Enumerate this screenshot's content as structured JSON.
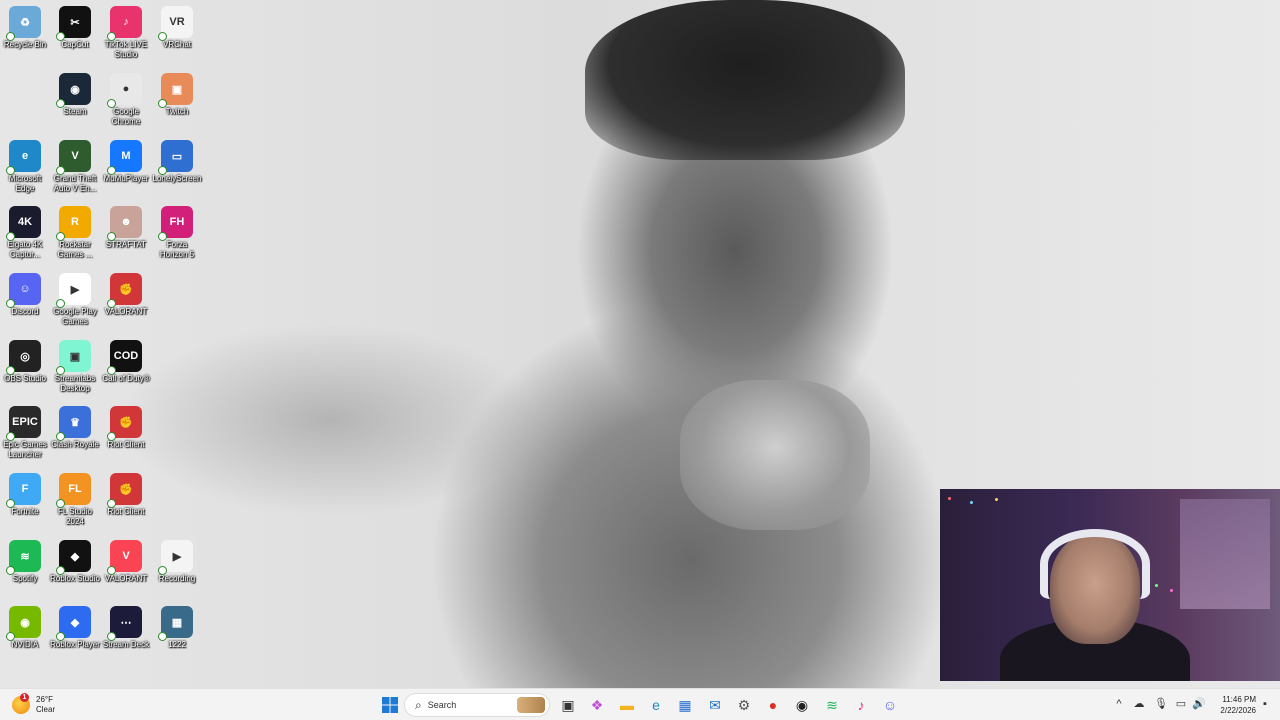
{
  "desktop": {
    "icons": [
      {
        "label": "Recycle Bin",
        "name": "recycle-bin-icon",
        "glyph": "♻",
        "bg": "#6aa9d8"
      },
      {
        "label": "CapCut",
        "name": "capcut-icon",
        "glyph": "✂",
        "bg": "#111111"
      },
      {
        "label": "TikTok LIVE Studio",
        "name": "tiktok-live-studio-icon",
        "glyph": "♪",
        "bg": "#e8336d"
      },
      {
        "label": "VRChat",
        "name": "vrchat-icon",
        "glyph": "VR",
        "bg": "#f4f4f4"
      },
      {
        "label": "Steam",
        "name": "steam-icon",
        "glyph": "◉",
        "bg": "#1b2838"
      },
      {
        "label": "Google Chrome",
        "name": "chrome-icon",
        "glyph": "●",
        "bg": "#e8e8e8"
      },
      {
        "label": "Twitch",
        "name": "twitch-icon",
        "glyph": "▣",
        "bg": "#e98b59"
      },
      {
        "label": "Microsoft Edge",
        "name": "edge-icon",
        "glyph": "e",
        "bg": "#1e88c9"
      },
      {
        "label": "Grand Theft Auto V En...",
        "name": "gta-icon",
        "glyph": "V",
        "bg": "#2e5c2f"
      },
      {
        "label": "MuMuPlayer",
        "name": "mumuplayer-icon",
        "glyph": "M",
        "bg": "#1677ff"
      },
      {
        "label": "LonelyScreen",
        "name": "lonelyscreen-icon",
        "glyph": "▭",
        "bg": "#2f6fd1"
      },
      {
        "label": "Elgato 4K Captur...",
        "name": "elgato-icon",
        "glyph": "4K",
        "bg": "#1b1b2e"
      },
      {
        "label": "Rockstar Games ...",
        "name": "rockstar-icon",
        "glyph": "R",
        "bg": "#f2a900"
      },
      {
        "label": "STRAFTAT",
        "name": "straftat-icon",
        "glyph": "☻",
        "bg": "#c9a29a"
      },
      {
        "label": "Forza Horizon 5",
        "name": "forza-icon",
        "glyph": "FH",
        "bg": "#d21f7a"
      },
      {
        "label": "Discord",
        "name": "discord-icon",
        "glyph": "☺",
        "bg": "#5865f2"
      },
      {
        "label": "Google Play Games",
        "name": "google-play-games-icon",
        "glyph": "▶",
        "bg": "#ffffff"
      },
      {
        "label": "VALORANT",
        "name": "valorant-riot-icon",
        "glyph": "✊",
        "bg": "#d13639"
      },
      {
        "label": "OBS Studio",
        "name": "obs-icon",
        "glyph": "◎",
        "bg": "#222222"
      },
      {
        "label": "Streamlabs Desktop",
        "name": "streamlabs-icon",
        "glyph": "▣",
        "bg": "#80f5d2"
      },
      {
        "label": "Call of Duty®",
        "name": "call-of-duty-icon",
        "glyph": "COD",
        "bg": "#111111"
      },
      {
        "label": "Epic Games Launcher",
        "name": "epic-games-icon",
        "glyph": "EPIC",
        "bg": "#2a2a2a"
      },
      {
        "label": "Clash Royale",
        "name": "clash-royale-icon",
        "glyph": "♛",
        "bg": "#3b6fd9"
      },
      {
        "label": "Riot Client",
        "name": "riot-client-icon-1",
        "glyph": "✊",
        "bg": "#d13639"
      },
      {
        "label": "Fortnite",
        "name": "fortnite-icon",
        "glyph": "F",
        "bg": "#3fa9f5"
      },
      {
        "label": "FL Studio 2024",
        "name": "fl-studio-icon",
        "glyph": "FL",
        "bg": "#f29322"
      },
      {
        "label": "Riot Client",
        "name": "riot-client-icon-2",
        "glyph": "✊",
        "bg": "#d13639"
      },
      {
        "label": "Spotify",
        "name": "spotify-icon",
        "glyph": "≋",
        "bg": "#1db954"
      },
      {
        "label": "Roblox Studio",
        "name": "roblox-studio-icon",
        "glyph": "◆",
        "bg": "#111111"
      },
      {
        "label": "VALORANT",
        "name": "valorant-icon",
        "glyph": "V",
        "bg": "#fa4454"
      },
      {
        "label": "Recording",
        "name": "recording-file-icon",
        "glyph": "▶",
        "bg": "#f4f4f4"
      },
      {
        "label": "NVIDIA",
        "name": "nvidia-icon",
        "glyph": "◉",
        "bg": "#76b900"
      },
      {
        "label": "Roblox Player",
        "name": "roblox-player-icon",
        "glyph": "◆",
        "bg": "#2d6cf0"
      },
      {
        "label": "Stream Deck",
        "name": "stream-deck-icon",
        "glyph": "⋯",
        "bg": "#1c1c3a"
      },
      {
        "label": "1222",
        "name": "video-file-icon",
        "glyph": "▦",
        "bg": "#3a6a8a"
      }
    ]
  },
  "taskbar": {
    "weather": {
      "temp": "26°F",
      "condition": "Clear",
      "badge": "1"
    },
    "search_placeholder": "Search",
    "pinned": [
      {
        "name": "task-view-icon",
        "glyph": "▣",
        "color": "#333333"
      },
      {
        "name": "copilot-icon",
        "glyph": "❖",
        "color": "#c04fd8"
      },
      {
        "name": "file-explorer-icon",
        "glyph": "▬",
        "color": "#f2b31d"
      },
      {
        "name": "edge-taskbar-icon",
        "glyph": "e",
        "color": "#1e88c9"
      },
      {
        "name": "microsoft-store-icon",
        "glyph": "▦",
        "color": "#2a6fd1"
      },
      {
        "name": "outlook-icon",
        "glyph": "✉",
        "color": "#1a73c9"
      },
      {
        "name": "settings-icon",
        "glyph": "⚙",
        "color": "#555555"
      },
      {
        "name": "chrome-taskbar-icon",
        "glyph": "●",
        "color": "#d93025"
      },
      {
        "name": "github-icon",
        "glyph": "◉",
        "color": "#222222"
      },
      {
        "name": "spotify-taskbar-icon",
        "glyph": "≋",
        "color": "#1db954"
      },
      {
        "name": "tiktok-taskbar-icon",
        "glyph": "♪",
        "color": "#e8336d"
      },
      {
        "name": "discord-taskbar-icon",
        "glyph": "☺",
        "color": "#5865f2"
      }
    ],
    "tray": {
      "chevron": "^",
      "time": "11:46 PM",
      "date": "2/22/2026"
    }
  }
}
